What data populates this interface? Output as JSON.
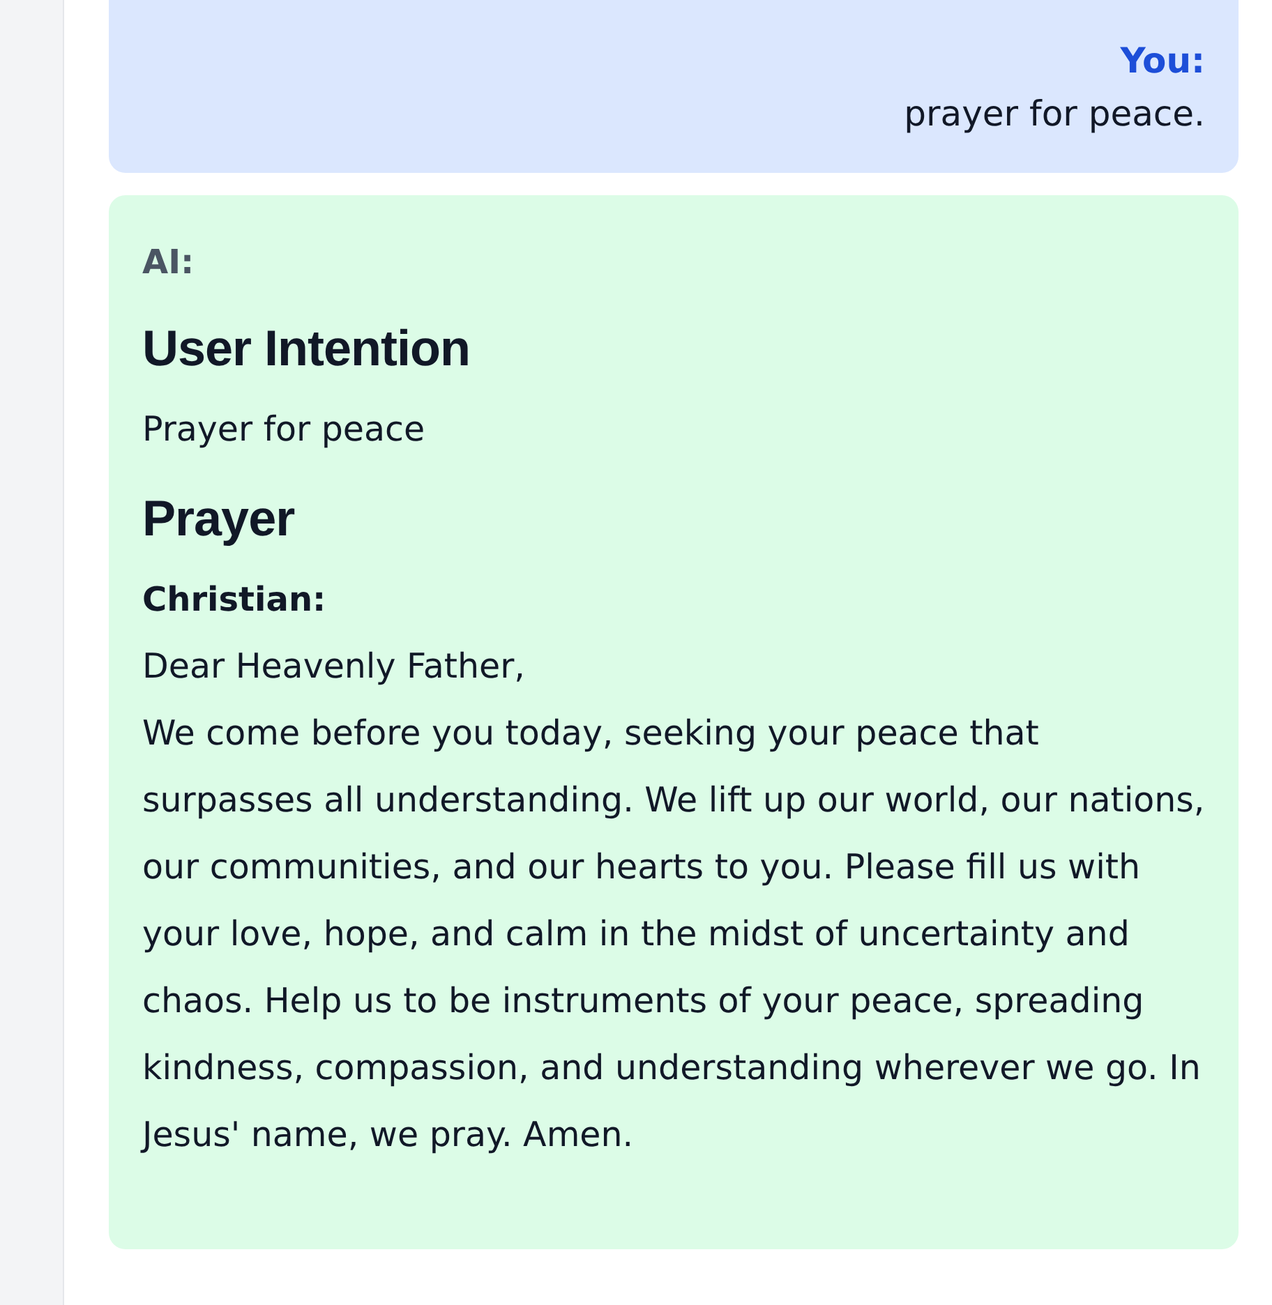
{
  "messages": [
    {
      "kind": "user",
      "speaker": "You:",
      "text": "prayer for peace."
    },
    {
      "kind": "ai",
      "speaker": "AI:",
      "sections": [
        {
          "heading": "User Intention",
          "blocks": [
            {
              "kind": "text",
              "text": "Prayer for peace"
            }
          ]
        },
        {
          "heading": "Prayer",
          "blocks": [
            {
              "kind": "label",
              "text": "Christian:"
            },
            {
              "kind": "text",
              "text": "Dear Heavenly Father,"
            },
            {
              "kind": "text",
              "text": "We come before you today, seeking your peace that surpasses all understanding. We lift up our world, our nations, our communities, and our hearts to you. Please fill us with your love, hope, and calm in the midst of uncertainty and chaos. Help us to be instruments of your peace, spreading kindness, compassion, and understanding wherever we go. In Jesus' name, we pray. Amen."
            }
          ]
        }
      ]
    }
  ]
}
